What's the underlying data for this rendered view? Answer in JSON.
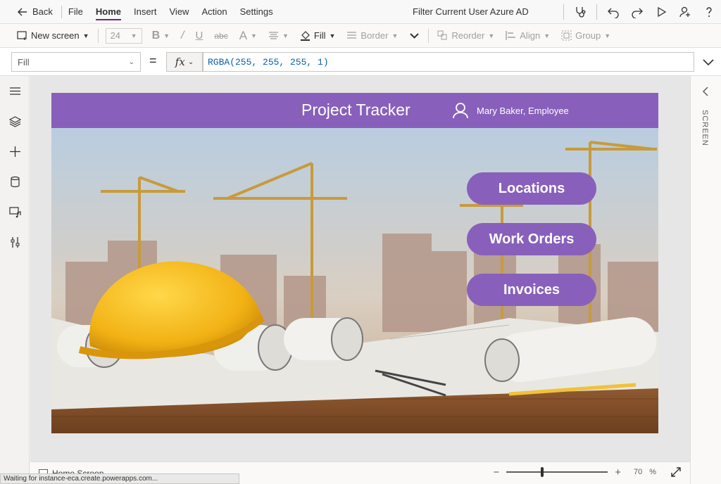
{
  "topbar": {
    "back_label": "Back",
    "menu": [
      "File",
      "Home",
      "Insert",
      "View",
      "Action",
      "Settings"
    ],
    "active_menu": "Home",
    "app_title": "Filter Current User Azure AD",
    "icons": [
      "stethoscope-icon",
      "undo-icon",
      "redo-icon",
      "play-icon",
      "share-user-icon",
      "help-icon"
    ]
  },
  "ribbon": {
    "new_screen_label": "New screen",
    "font_size": "24",
    "fill_label": "Fill",
    "border_label": "Border",
    "reorder_label": "Reorder",
    "align_label": "Align",
    "group_label": "Group"
  },
  "formula": {
    "property": "Fill",
    "equals": "=",
    "fx": "fx",
    "expression": "RGBA(255, 255, 255, 1)"
  },
  "left_rail": [
    "hamburger-icon",
    "layers-icon",
    "add-icon",
    "data-icon",
    "media-icon",
    "tools-icon"
  ],
  "right_rail": {
    "label": "SCREEN"
  },
  "app": {
    "title": "Project Tracker",
    "user": "Mary Baker, Employee",
    "buttons": [
      "Locations",
      "Work Orders",
      "Invoices"
    ],
    "accent": "#8860bb"
  },
  "status": {
    "screen_name": "Home Screen",
    "zoom_minus": "−",
    "zoom_plus": "+",
    "zoom_value": "70",
    "zoom_unit": "%",
    "zoom_fraction": 0.35,
    "waiting": "Waiting for instance-eca.create.powerapps.com..."
  }
}
